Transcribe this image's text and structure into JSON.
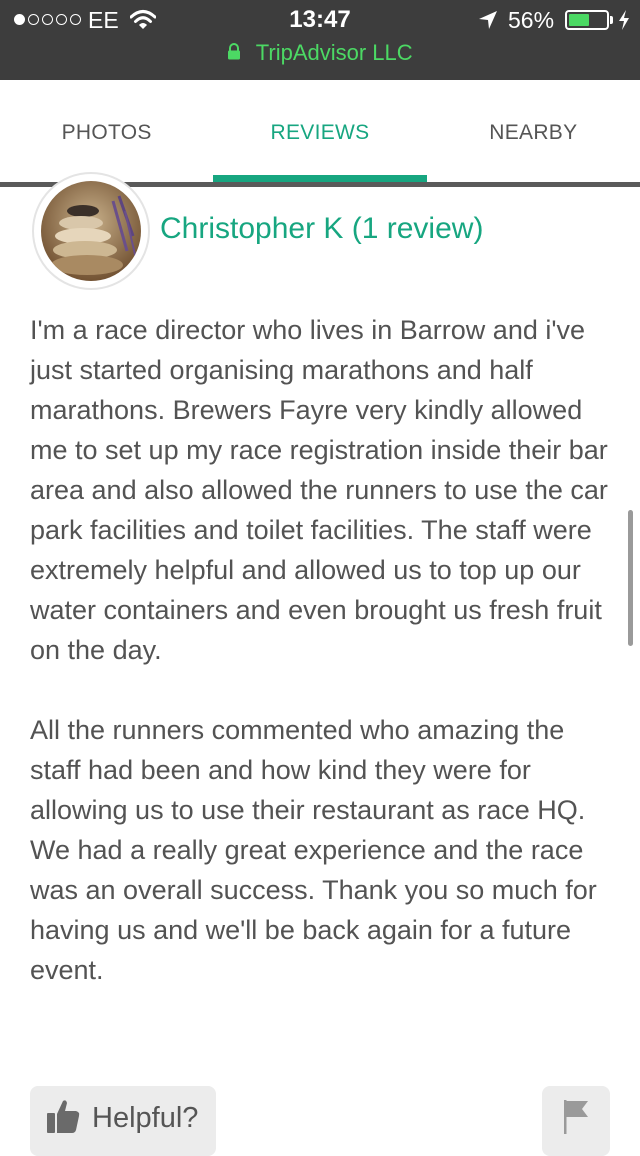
{
  "status_bar": {
    "carrier": "EE",
    "time": "13:47",
    "battery": "56%",
    "battery_level": 0.56,
    "icons": [
      "signal-dots",
      "wifi-icon",
      "location-arrow-icon",
      "battery-icon",
      "charging-bolt-icon"
    ]
  },
  "url_bar": {
    "site": "TripAdvisor LLC",
    "icon": "lock-icon",
    "color": "#4cd964"
  },
  "tabs": [
    {
      "label": "PHOTOS",
      "active": false
    },
    {
      "label": "REVIEWS",
      "active": true
    },
    {
      "label": "NEARBY",
      "active": false
    }
  ],
  "accent_color": "#17a680",
  "review": {
    "reviewer": "Christopher K (1 review)",
    "paragraphs": [
      "I'm a race director who lives in Barrow and i've just started organising marathons and half marathons. Brewers Fayre very kindly allowed me to set up my race registration inside their bar area and also allowed the runners to use the car park facilities and toilet facilities. The staff were extremely helpful and allowed us to top up our water containers and even brought us fresh fruit on the day.",
      "All the runners commented who amazing the staff had been and how kind they were for allowing us to use their restaurant as race HQ.",
      "We had a really great experience and the race was an overall success. Thank you so much for having us and we'll be back again for a future event."
    ]
  },
  "actions": {
    "helpful_label": "Helpful?",
    "helpful_icon": "thumbs-up-icon",
    "report_icon": "flag-icon"
  }
}
